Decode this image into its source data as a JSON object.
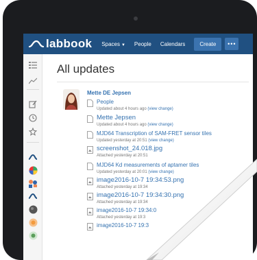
{
  "app": {
    "name": "labbook"
  },
  "nav": {
    "spaces": "Spaces",
    "people": "People",
    "calendars": "Calendars",
    "create": "Create",
    "more": "•••"
  },
  "page": {
    "title": "All updates"
  },
  "feed": {
    "author": "Mette DE Jepsen",
    "entries": [
      {
        "label": "People",
        "meta": "Updated about 4 hours ago",
        "change": "(view change)"
      },
      {
        "label": "Mette Jepsen",
        "meta": "Updated about 4 hours ago",
        "change": "(view change)"
      },
      {
        "label": "MJD64 Transcription of SAM-FRET sensor tiles",
        "meta": "Updated yesterday at 20:51",
        "change": "(view change)"
      },
      {
        "label": "screenshot_24.018.jpg",
        "meta": "Attached yesterday at 20:51",
        "change": ""
      },
      {
        "label": "MJD64 Kd measurements of aptamer tiles",
        "meta": "Updated yesterday at 20:01",
        "change": "(view change)"
      },
      {
        "label": "image2016-10-7 19:34:53.png",
        "meta": "Attached yesterday at 19:34",
        "change": ""
      },
      {
        "label": "image2016-10-7 19:34:30.png",
        "meta": "Attached yesterday at 19:34",
        "change": ""
      },
      {
        "label": "image2016-10-7 19:34:0",
        "meta": "Attached yesterday at 19:3",
        "change": ""
      },
      {
        "label": "image2016-10-7 19:3",
        "meta": "",
        "change": ""
      }
    ]
  },
  "sidebar": {
    "icons": [
      "menu-icon",
      "activity-icon",
      "edit-icon",
      "clock-icon",
      "star-icon",
      "labbook-space-icon",
      "colorful-space-icon",
      "people-space-icon",
      "labbook-space-icon-2",
      "dark-space-icon",
      "orange-space-icon",
      "green-space-icon"
    ]
  },
  "colors": {
    "brand": "#205081",
    "button": "#3b73af",
    "link": "#3572b0"
  }
}
